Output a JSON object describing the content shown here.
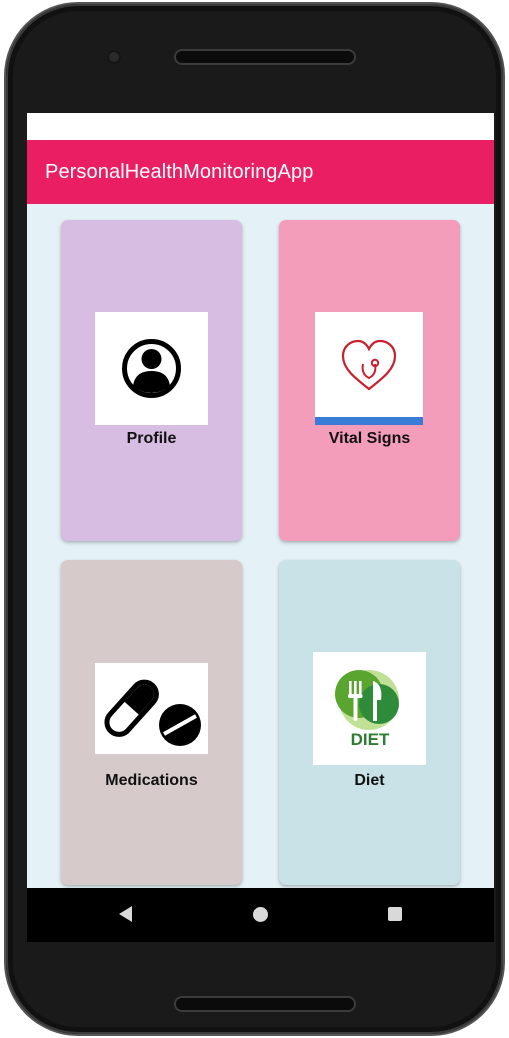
{
  "app": {
    "title": "PersonalHealthMonitoringApp",
    "accent_color": "#e91e63"
  },
  "tiles": [
    {
      "label": "Profile",
      "icon": "user-avatar-icon",
      "color": "#d7bde2"
    },
    {
      "label": "Vital Signs",
      "icon": "heart-stethoscope-icon",
      "color": "#f49dbb"
    },
    {
      "label": "Medications",
      "icon": "pills-icon",
      "color": "#d7caca"
    },
    {
      "label": "Diet",
      "icon": "diet-fork-knife-icon",
      "color": "#c8e2e8",
      "image_text": "DIET"
    }
  ],
  "navigation": {
    "back_icon": "triangle-back-icon",
    "home_icon": "circle-home-icon",
    "recents_icon": "square-recents-icon"
  }
}
